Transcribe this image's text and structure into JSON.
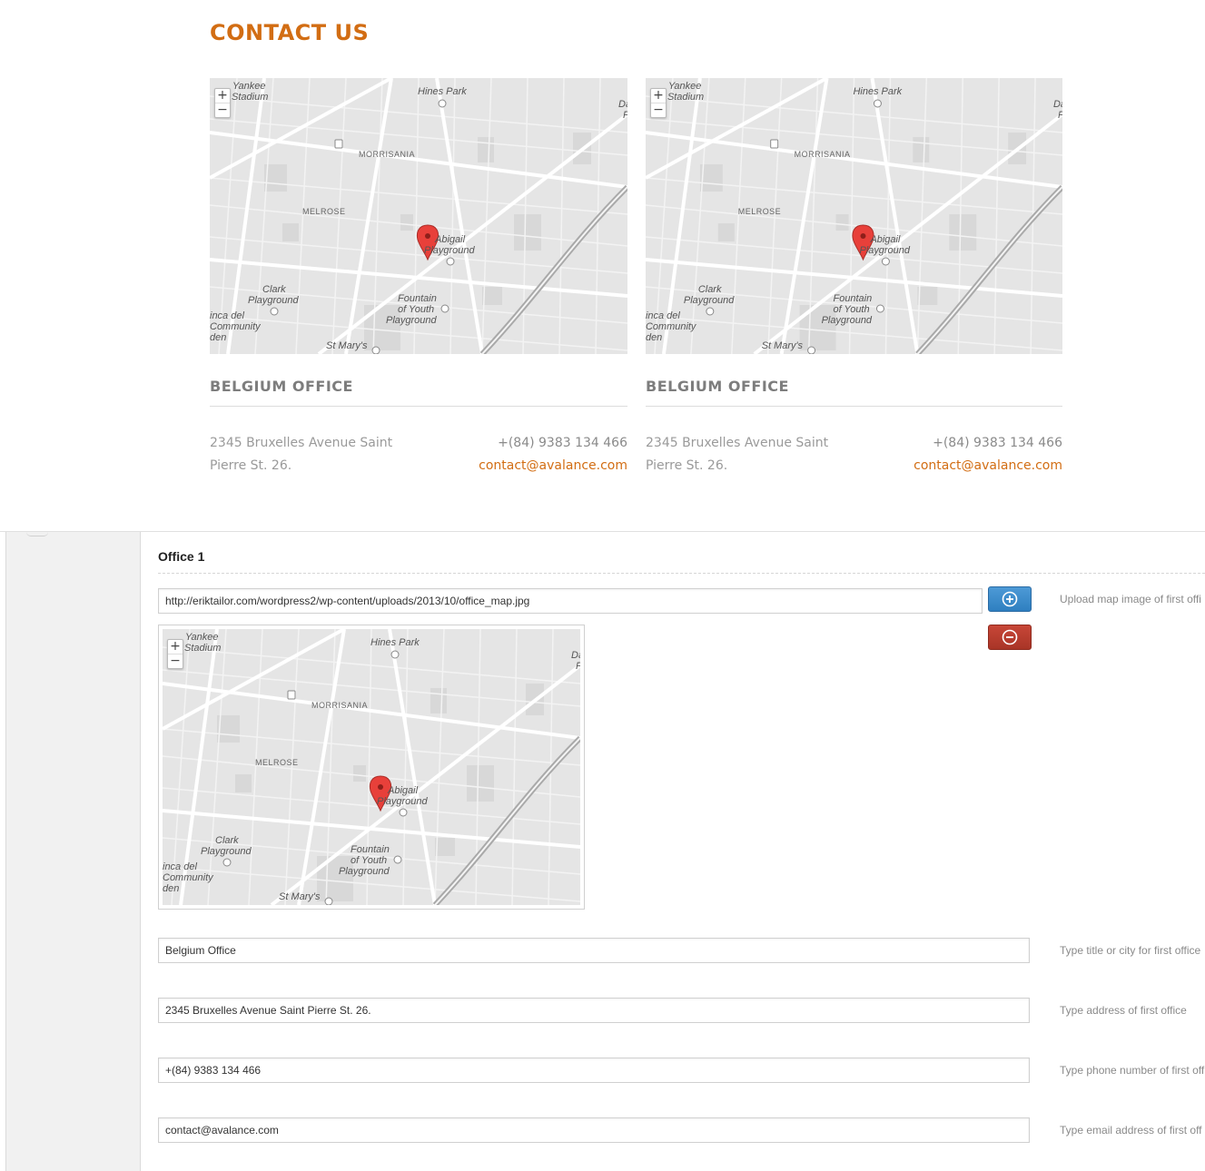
{
  "contact": {
    "title": "CONTACT US",
    "offices": [
      {
        "name": "BELGIUM OFFICE",
        "address_line1": "2345 Bruxelles Avenue Saint",
        "address_line2": "Pierre St. 26.",
        "phone": "+(84) 9383 134 466",
        "email": "contact@avalance.com"
      },
      {
        "name": "BELGIUM OFFICE",
        "address_line1": "2345 Bruxelles Avenue Saint",
        "address_line2": "Pierre St. 26.",
        "phone": "+(84) 9383 134 466",
        "email": "contact@avalance.com"
      }
    ]
  },
  "map": {
    "zoom_in": "+",
    "zoom_out": "−",
    "labels": {
      "yankee": "Yankee",
      "stadium": "Stadium",
      "hines_park": "Hines Park",
      "morrisania": "MORRISANIA",
      "melrose": "MELROSE",
      "abigail": "Abigail",
      "playground": "Playground",
      "clark": "Clark",
      "clark_playground": "Playground",
      "fountain": "Fountain",
      "of_youth": "of Youth",
      "fountain_playground": "Playground",
      "inca_del": "inca del",
      "community": "Community",
      "den": "den",
      "st_marys": "St Mary's",
      "edge_da": "Da",
      "edge_f": "F"
    },
    "colors": {
      "land": "#e5e5e5",
      "road": "#ffffff",
      "block": "#d6d6d6",
      "marker": "#e8403a"
    }
  },
  "admin": {
    "section_title": "Office 1",
    "map_url": "http://eriktailor.com/wordpress2/wp-content/uploads/2013/10/office_map.jpg",
    "map_url_hint": "Upload map image of first offi",
    "add_icon": "plus-circle-icon",
    "remove_icon": "minus-circle-icon",
    "title_value": "Belgium Office",
    "title_hint": "Type title or city for first office",
    "address_value": "2345 Bruxelles Avenue Saint Pierre St. 26.",
    "address_hint": "Type address of first office",
    "phone_value": "+(84) 9383 134 466",
    "phone_hint": "Type phone number of first off",
    "email_value": "contact@avalance.com",
    "email_hint": "Type email address of first off"
  }
}
